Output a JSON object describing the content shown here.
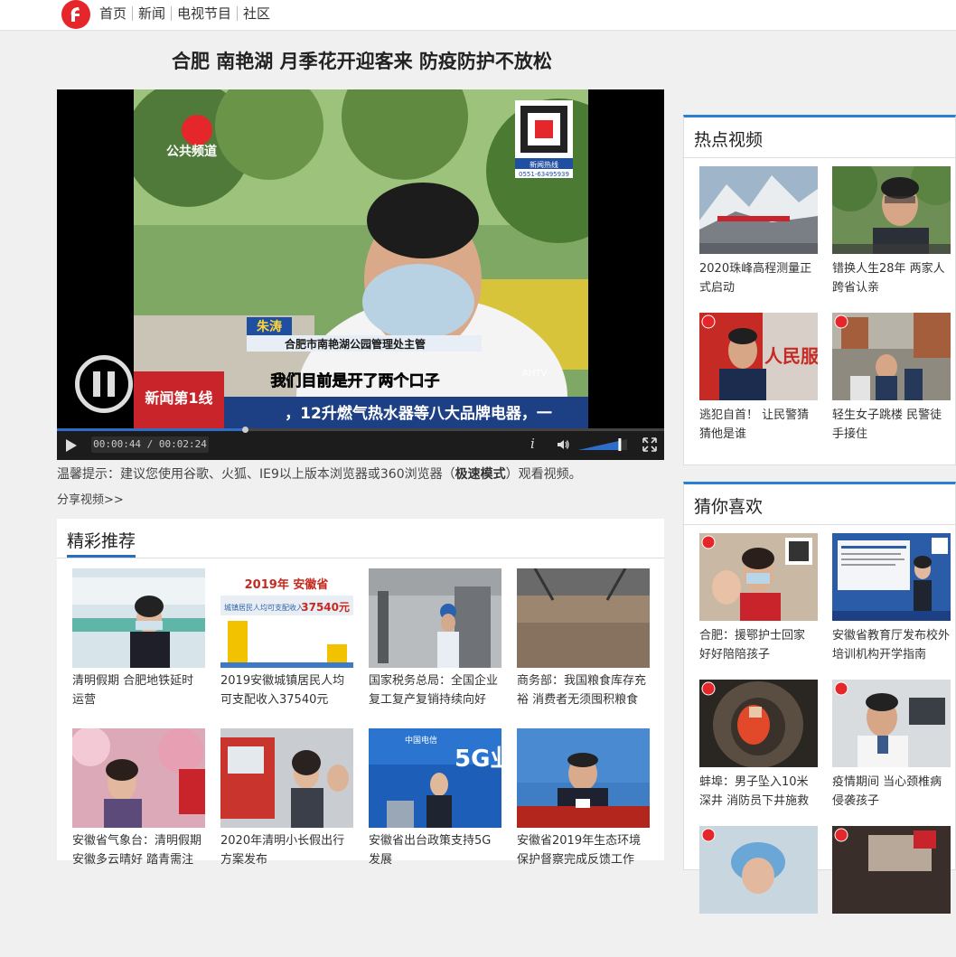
{
  "nav": {
    "items": [
      "首页",
      "新闻",
      "电视节目",
      "社区"
    ]
  },
  "article": {
    "title": "合肥 南艳湖 月季花开迎客来 防疫防护不放松"
  },
  "player": {
    "overlay": {
      "channel_logo": "公共频道",
      "hotline": "新闻热线",
      "hotline_number": "0551-63495939",
      "name_tag": "朱涛",
      "name_title": "合肥市南艳湖公园管理处主管",
      "subtitle": "我们目前是开了两个口子",
      "ticker": "，12升燃气热水器等八大品牌电器，一",
      "program_tag": "新闻第1线",
      "watermark": "AHTV"
    },
    "time": "00:00:44 / 00:02:24",
    "progress": 0.31,
    "volume": 0.85,
    "info_label": "i"
  },
  "tip": {
    "prefix": "温馨提示：建议您使用谷歌、火狐、IE9以上版本浏览器或360浏览器（",
    "bold": "极速模式",
    "suffix": "）观看视频。"
  },
  "share": "分享视频>>",
  "recommend": {
    "title": "精彩推荐",
    "items": [
      {
        "caption": "清明假期 合肥地铁延时运营"
      },
      {
        "caption": "2019安徽城镇居民人均可支配收入37540元",
        "thumb_title": "2019年 安徽省",
        "thumb_sub": "城镇居民人均可支配收入",
        "thumb_value": "37540元"
      },
      {
        "caption": "国家税务总局：全国企业复工复产复销持续向好"
      },
      {
        "caption": "商务部：我国粮食库存充裕 消费者无须囤积粮食"
      },
      {
        "caption": "安徽省气象台：清明假期安徽多云晴好 踏青需注意"
      },
      {
        "caption": "2020年清明小长假出行方案发布"
      },
      {
        "caption": "安徽省出台政策支持5G发展",
        "thumb_text": "5G业",
        "thumb_brand": "中国电信"
      },
      {
        "caption": "安徽省2019年生态环境保护督察完成反馈工作"
      }
    ]
  },
  "hot_videos": {
    "title": "热点视频",
    "items": [
      {
        "caption": "2020珠峰高程测量正式启动"
      },
      {
        "caption": "错换人生28年 两家人跨省认亲"
      },
      {
        "caption": "逃犯自首！ 让民警猜猜他是谁",
        "thumb_text": "人民服"
      },
      {
        "caption": "轻生女子跳楼 民警徒手接住"
      }
    ]
  },
  "guess": {
    "title": "猜你喜欢",
    "items": [
      {
        "caption": "合肥：援鄂护士回家 好好陪陪孩子"
      },
      {
        "caption": "安徽省教育厅发布校外培训机构开学指南"
      },
      {
        "caption": "蚌埠：男子坠入10米深井 消防员下井施救"
      },
      {
        "caption": "疫情期间 当心颈椎病侵袭孩子"
      },
      {
        "caption": ""
      },
      {
        "caption": ""
      }
    ]
  },
  "colors": {
    "brand_red": "#e5262b",
    "accent_blue": "#2a6ebb",
    "page_bg": "#f0f0f0"
  }
}
